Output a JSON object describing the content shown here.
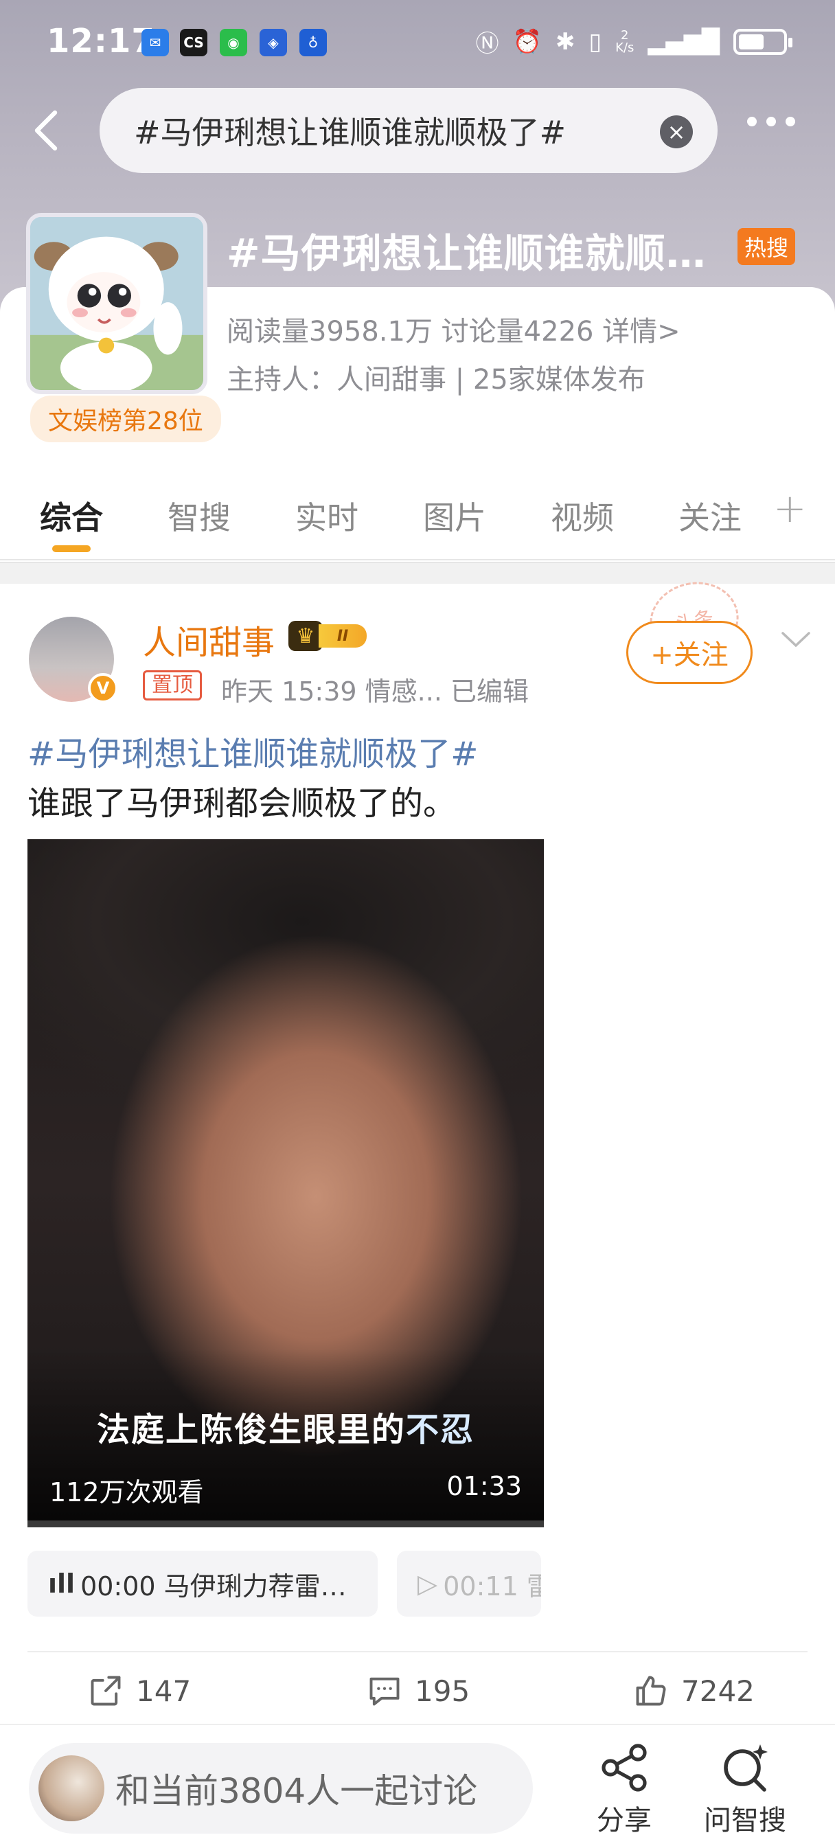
{
  "status_bar": {
    "time": "12:17",
    "net_speed": "2\nK/s",
    "apps": [
      "mail-app-icon",
      "cs-app-icon",
      "wechat-icon",
      "blue-app-icon",
      "bulb-app-icon"
    ],
    "cs_label": "CS"
  },
  "search": {
    "query": "#马伊琍想让谁顺谁就顺极了#"
  },
  "topic": {
    "title": "#马伊琍想让谁顺谁就顺…",
    "hot_badge": "热搜",
    "meta": "阅读量3958.1万  讨论量4226  详情>",
    "host": "主持人：人间甜事 | 25家媒体发布",
    "rank": "文娱榜第28位"
  },
  "tabs": [
    {
      "label": "综合",
      "active": true
    },
    {
      "label": "智搜"
    },
    {
      "label": "实时"
    },
    {
      "label": "图片"
    },
    {
      "label": "视频"
    },
    {
      "label": "关注"
    }
  ],
  "post": {
    "author": "人间甜事",
    "vip_level": "II",
    "pinned": "置顶",
    "meta": "昨天 15:39  情感...  已编辑",
    "follow": "+关注",
    "stamp": "头条",
    "tag": "#马伊琍想让谁顺谁就顺极了#",
    "body": "谁跟了马伊琍都会顺极了的。",
    "video": {
      "caption_main": "法庭上陈俊生眼里的",
      "caption_hl": "不忍",
      "views": "112万次观看",
      "duration": "01:33"
    },
    "chips": [
      {
        "text": "00:00  马伊琍力荐雷…"
      },
      {
        "text": "00:11  雷"
      }
    ],
    "actions": {
      "share": "147",
      "comment": "195",
      "like": "7242"
    }
  },
  "bottom": {
    "discuss": "和当前3804人一起讨论",
    "share_label": "分享",
    "ask_label": "问智搜"
  },
  "colors": {
    "accent": "#f08a1c",
    "hot": "#f47a1f",
    "tag_blue": "#5a7db0"
  }
}
